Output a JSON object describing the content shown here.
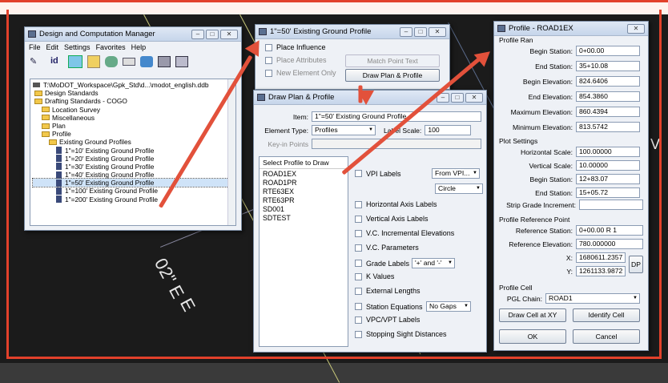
{
  "colors": {
    "accent": "#e2412b",
    "arrow": "#e2513b"
  },
  "cad": {
    "bearing": "02\" E",
    "label_e": "E",
    "label_v": "V"
  },
  "dcm": {
    "title": "Design and Computation Manager",
    "menu": [
      "File",
      "Edit",
      "Settings",
      "Favorites",
      "Help"
    ],
    "path": "T:\\MoDOT_Workspace\\Gpk_Std\\d...\\modot_english.ddb",
    "tree": [
      {
        "label": "Design Standards",
        "level": 1,
        "type": "folder"
      },
      {
        "label": "Drafting Standards - COGO",
        "level": 1,
        "type": "folder"
      },
      {
        "label": "Location Survey",
        "level": 2,
        "type": "folder"
      },
      {
        "label": "Miscellaneous",
        "level": 2,
        "type": "folder"
      },
      {
        "label": "Plan",
        "level": 2,
        "type": "folder"
      },
      {
        "label": "Profile",
        "level": 2,
        "type": "folder"
      },
      {
        "label": "Existing Ground Profiles",
        "level": 3,
        "type": "folder"
      },
      {
        "label": "1\"=10' Existing Ground Profile",
        "level": 4,
        "type": "item"
      },
      {
        "label": "1\"=20' Existing Ground Profile",
        "level": 4,
        "type": "item"
      },
      {
        "label": "1\"=30' Existing Ground Profile",
        "level": 4,
        "type": "item"
      },
      {
        "label": "1\"=40' Existing Ground Profile",
        "level": 4,
        "type": "item"
      },
      {
        "label": "1\"=50' Existing Ground Profile",
        "level": 4,
        "type": "item",
        "selected": true
      },
      {
        "label": "1\"=100' Existing Ground Profile",
        "level": 4,
        "type": "item"
      },
      {
        "label": "1\"=200' Existing Ground Profile",
        "level": 4,
        "type": "item"
      }
    ]
  },
  "egp": {
    "title": "1\"=50' Existing Ground Profile",
    "place_influence": "Place Influence",
    "place_attributes": "Place Attributes",
    "new_element_only": "New Element Only",
    "match_point_text": "Match Point Text",
    "draw_plan_profile": "Draw Plan & Profile"
  },
  "dpp": {
    "title": "Draw Plan & Profile",
    "item_label": "Item:",
    "item_value": "1\"=50' Existing Ground Profile",
    "element_type_label": "Element Type:",
    "element_type_value": "Profiles",
    "label_scale_label": "Label Scale:",
    "label_scale_value": "100",
    "key_in_points": "Key-in Points",
    "select_profile": "Select Profile to Draw",
    "profiles": [
      "ROAD1EX",
      "ROAD1PR",
      "RTE63EX",
      "RTE63PR",
      "SD001",
      "SDTEST"
    ],
    "vpi_labels": "VPI Labels",
    "vpi_select": "From VPI...",
    "circle_select": "Circle",
    "horizontal_axis_labels": "Horizontal Axis Labels",
    "vertical_axis_labels": "Vertical Axis Labels",
    "vc_incremental": "V.C. Incremental Elevations",
    "vc_parameters": "V.C. Parameters",
    "grade_labels": "Grade Labels",
    "grade_select": "'+' and '-'",
    "k_values": "K Values",
    "external_lengths": "External Lengths",
    "station_equations": "Station Equations",
    "station_select": "No Gaps",
    "vpc_vpt": "VPC/VPT Labels",
    "stopping_sight": "Stopping Sight Distances"
  },
  "profile": {
    "title": "Profile - ROAD1EX",
    "range_label": "Profile Ran",
    "fields": [
      {
        "label": "Begin Station:",
        "value": "0+00.00"
      },
      {
        "label": "End Station:",
        "value": "35+10.08"
      },
      {
        "label": "Begin Elevation:",
        "value": "824.6406"
      },
      {
        "label": "End Elevation:",
        "value": "854.3860"
      },
      {
        "label": "Maximum Elevation:",
        "value": "860.4394"
      },
      {
        "label": "Minimum Elevation:",
        "value": "813.5742"
      }
    ],
    "plot_settings": "Plot Settings",
    "plot_fields": [
      {
        "label": "Horizontal Scale:",
        "value": "100.00000"
      },
      {
        "label": "Vertical Scale:",
        "value": "10.00000"
      },
      {
        "label": "Begin Station:",
        "value": "12+83.07"
      },
      {
        "label": "End Station:",
        "value": "15+05.72"
      }
    ],
    "strip_grade": "Strip Grade Increment:",
    "strip_value": "",
    "ref_point": "Profile Reference Point",
    "ref_station_label": "Reference Station:",
    "ref_station_value": "0+00.00 R 1",
    "ref_elev_label": "Reference Elevation:",
    "ref_elev_value": "780.000000",
    "x_label": "X:",
    "x_value": "1680611.2357",
    "y_label": "Y:",
    "y_value": "1261133.9872",
    "dp": "DP",
    "profile_cell": "Profile Cell",
    "pgl_label": "PGL Chain:",
    "pgl_value": "ROAD1",
    "draw_cell": "Draw Cell at XY",
    "identify_cell": "Identify Cell",
    "ok": "OK",
    "cancel": "Cancel"
  }
}
